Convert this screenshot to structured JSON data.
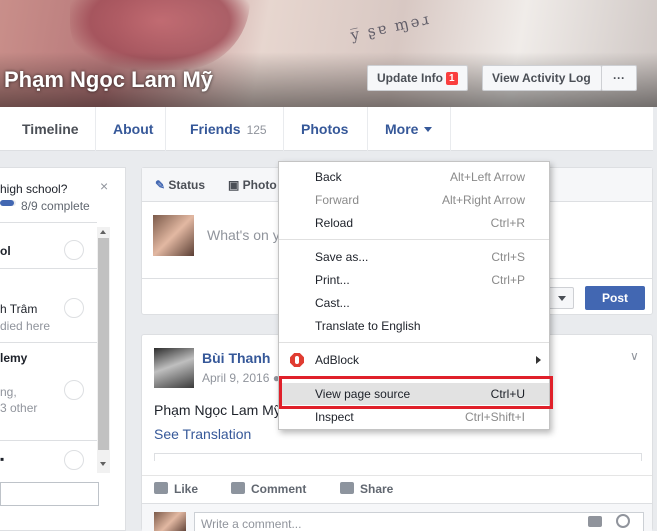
{
  "profile": {
    "name": "Phạm Ngọc Lam Mỹ",
    "cover_tattoo": "y̅ ʂɐ ɱǝɹ"
  },
  "cover_buttons": {
    "update_info": "Update Info",
    "update_badge": "1",
    "activity_log": "View Activity Log",
    "more": "···"
  },
  "tabs": {
    "timeline": "Timeline",
    "about": "About",
    "friends": "Friends",
    "friends_count": "125",
    "photos": "Photos",
    "more": "More"
  },
  "left_card": {
    "question": "high school?",
    "progress": "8/9 complete",
    "progress_fraction": 0.89,
    "close": "×",
    "items": [
      {
        "title": "ol",
        "sub": ""
      },
      {
        "title": "h Trâm",
        "sub": "died here"
      },
      {
        "title": "lemy",
        "sub": "ng,\n3 other"
      }
    ]
  },
  "composer": {
    "status": "Status",
    "photo": "Photo",
    "placeholder": "What's on y",
    "post_button": "Post"
  },
  "post": {
    "author": "Bùi Thanh",
    "date": "April 9, 2016",
    "text": "Phạm Ngọc Lam Mỹ",
    "see_translation": "See Translation",
    "actions": {
      "like": "Like",
      "comment": "Comment",
      "share": "Share"
    },
    "comment_placeholder": "Write a comment..."
  },
  "context_menu": {
    "items": [
      {
        "label": "Back",
        "shortcut": "Alt+Left Arrow",
        "disabled": false
      },
      {
        "label": "Forward",
        "shortcut": "Alt+Right Arrow",
        "disabled": true
      },
      {
        "label": "Reload",
        "shortcut": "Ctrl+R",
        "disabled": false
      },
      {
        "label": "Save as...",
        "shortcut": "Ctrl+S",
        "disabled": false
      },
      {
        "label": "Print...",
        "shortcut": "Ctrl+P",
        "disabled": false
      },
      {
        "label": "Cast...",
        "shortcut": "",
        "disabled": false
      },
      {
        "label": "Translate to English",
        "shortcut": "",
        "disabled": false
      },
      {
        "label": "AdBlock",
        "shortcut": "",
        "disabled": false
      },
      {
        "label": "View page source",
        "shortcut": "Ctrl+U",
        "disabled": false
      },
      {
        "label": "Inspect",
        "shortcut": "Ctrl+Shift+I",
        "disabled": false
      }
    ],
    "highlighted": "View page source",
    "highlight_color": "#e0202a"
  }
}
